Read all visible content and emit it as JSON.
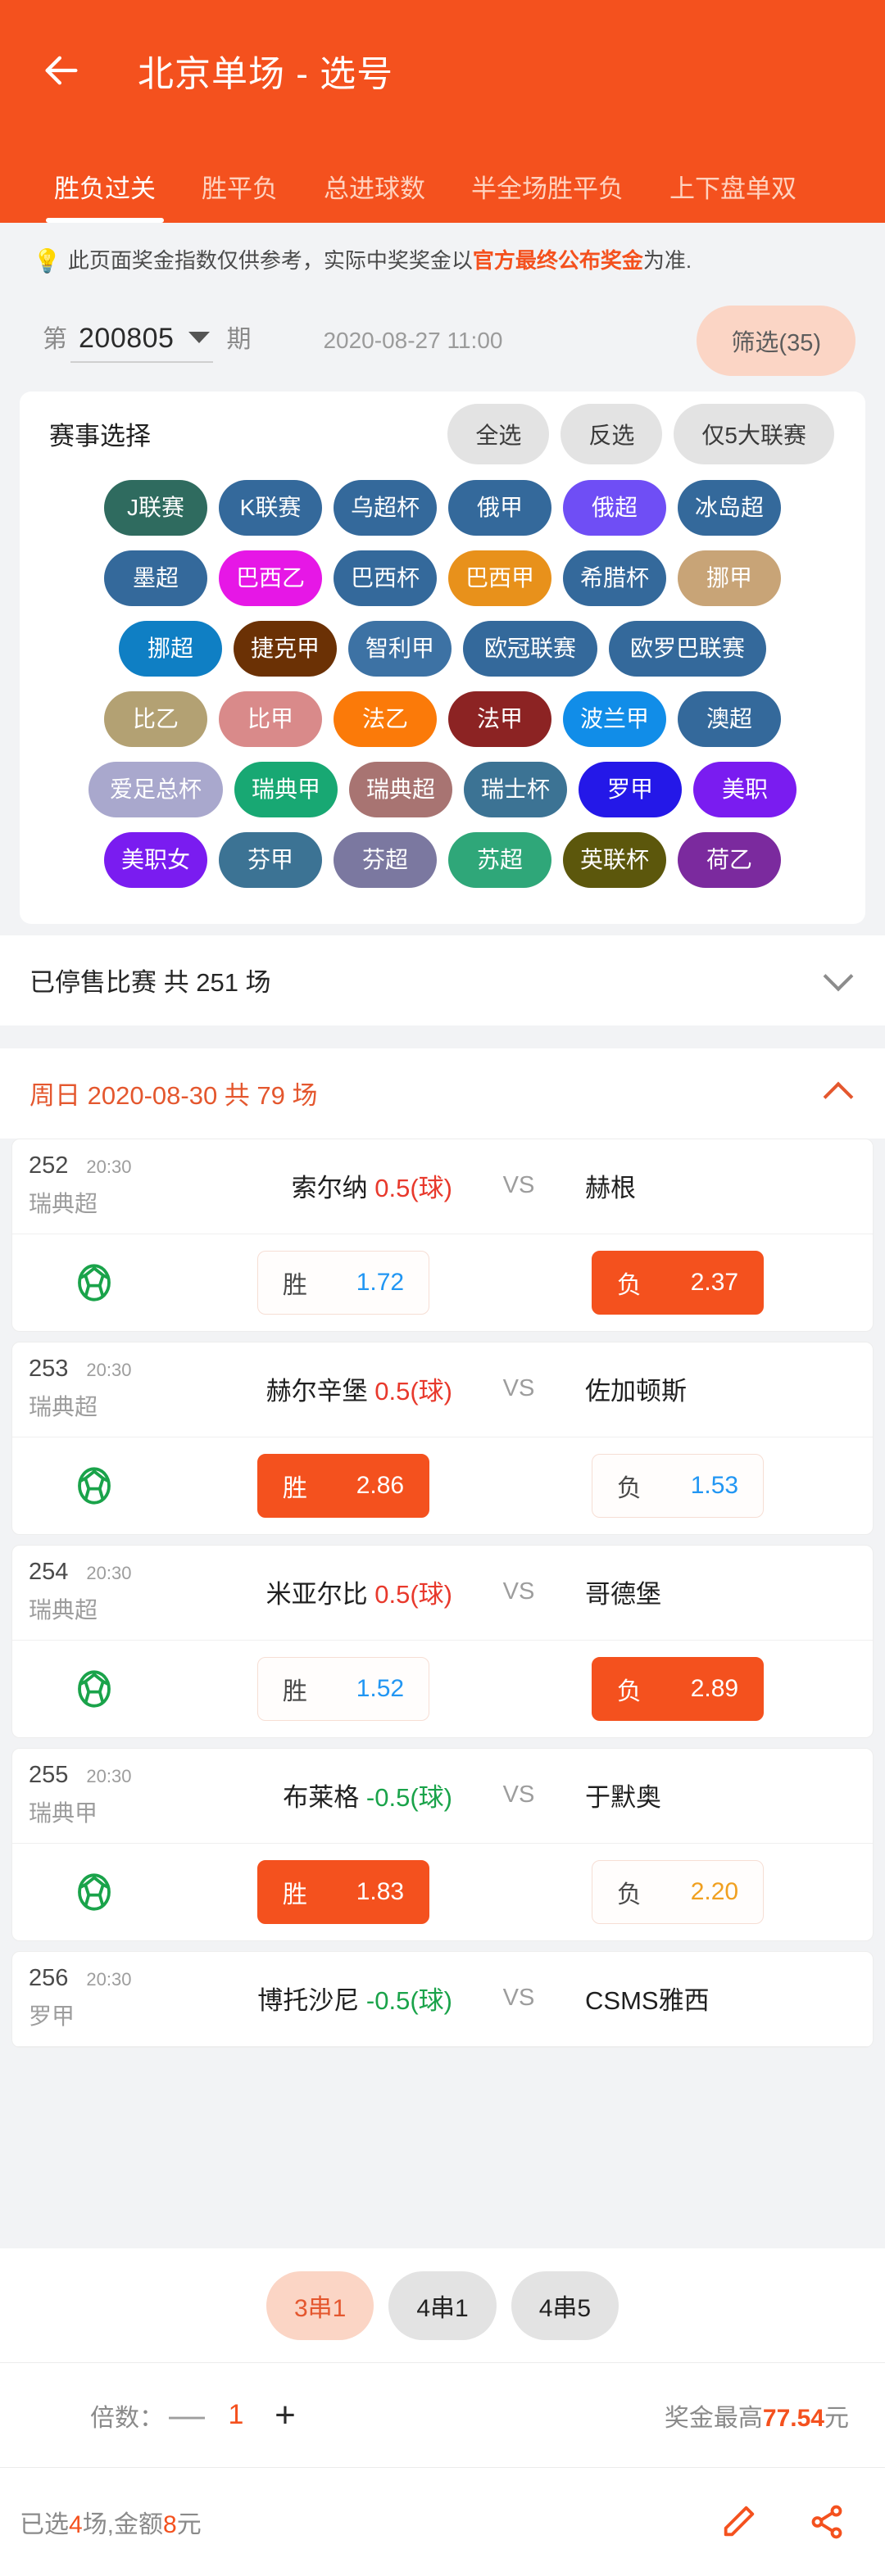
{
  "header": {
    "back_icon": "arrow-left-icon",
    "title": "北京单场 - 选号",
    "accent": "#f4511e",
    "tabs": [
      {
        "label": "胜负过关",
        "active": true
      },
      {
        "label": "胜平负",
        "active": false
      },
      {
        "label": "总进球数",
        "active": false
      },
      {
        "label": "半全场胜平负",
        "active": false
      },
      {
        "label": "上下盘单双",
        "active": false
      }
    ]
  },
  "notice": {
    "icon": "lightbulb-icon",
    "text_before": "此页面奖金指数仅供参考，实际中奖奖金以",
    "highlight": "官方最终公布奖金",
    "text_after": "为准."
  },
  "period": {
    "prefix": "第",
    "value": "200805",
    "suffix": "期",
    "dropdown_icon": "caret-down-icon",
    "datetime": "2020-08-27 11:00",
    "filter_label": "筛选(35)"
  },
  "league_panel": {
    "title": "赛事选择",
    "buttons": [
      {
        "label": "全选"
      },
      {
        "label": "反选"
      },
      {
        "label": "仅5大联赛"
      }
    ],
    "rows": [
      [
        {
          "label": "J联赛",
          "color": "#2f6b5f"
        },
        {
          "label": "K联赛",
          "color": "#34699b"
        },
        {
          "label": "乌超杯",
          "color": "#34699b"
        },
        {
          "label": "俄甲",
          "color": "#34699b"
        },
        {
          "label": "俄超",
          "color": "#6f4ef5"
        },
        {
          "label": "冰岛超",
          "color": "#34699b"
        }
      ],
      [
        {
          "label": "墨超",
          "color": "#34699b"
        },
        {
          "label": "巴西乙",
          "color": "#e617e6"
        },
        {
          "label": "巴西杯",
          "color": "#34699b"
        },
        {
          "label": "巴西甲",
          "color": "#e8911b"
        },
        {
          "label": "希腊杯",
          "color": "#34699b"
        },
        {
          "label": "挪甲",
          "color": "#c8a477"
        }
      ],
      [
        {
          "label": "挪超",
          "color": "#0f7fc4"
        },
        {
          "label": "捷克甲",
          "color": "#6b3105"
        },
        {
          "label": "智利甲",
          "color": "#3d72a4"
        },
        {
          "label": "欧冠联赛",
          "color": "#34699b"
        },
        {
          "label": "欧罗巴联赛",
          "color": "#34699b"
        }
      ],
      [
        {
          "label": "比乙",
          "color": "#b3a173"
        },
        {
          "label": "比甲",
          "color": "#d98a8a"
        },
        {
          "label": "法乙",
          "color": "#fb7a09"
        },
        {
          "label": "法甲",
          "color": "#8c2323"
        },
        {
          "label": "波兰甲",
          "color": "#118de8"
        },
        {
          "label": "澳超",
          "color": "#34699b"
        }
      ],
      [
        {
          "label": "爱足总杯",
          "color": "#a9a8cd"
        },
        {
          "label": "瑞典甲",
          "color": "#18a873"
        },
        {
          "label": "瑞典超",
          "color": "#a87472"
        },
        {
          "label": "瑞士杯",
          "color": "#3c7394"
        },
        {
          "label": "罗甲",
          "color": "#2418e8"
        },
        {
          "label": "美职",
          "color": "#7a1cf0"
        }
      ],
      [
        {
          "label": "美职女",
          "color": "#7a1cf0"
        },
        {
          "label": "芬甲",
          "color": "#3c7394"
        },
        {
          "label": "芬超",
          "color": "#7b78a0"
        },
        {
          "label": "苏超",
          "color": "#2fa779"
        },
        {
          "label": "英联杯",
          "color": "#5c570c"
        },
        {
          "label": "荷乙",
          "color": "#7b2a9e"
        }
      ]
    ]
  },
  "closed_bar": {
    "title": "已停售比赛 共 251 场",
    "icon": "chevron-down-icon"
  },
  "day_bar": {
    "title": "周日 2020-08-30 共 79 场",
    "icon": "chevron-up-icon"
  },
  "matches": [
    {
      "num": "252",
      "time": "20:30",
      "league": "瑞典超",
      "home": "索尔纳",
      "handicap": "0.5(球)",
      "handicap_sign": "pos",
      "vs": "VS",
      "away": "赫根",
      "ball_icon": "football-icon",
      "odds": [
        {
          "label": "胜",
          "value": "1.72",
          "selected": false,
          "value_color": "blue"
        },
        {
          "label": "负",
          "value": "2.37",
          "selected": true,
          "value_color": "blue"
        }
      ]
    },
    {
      "num": "253",
      "time": "20:30",
      "league": "瑞典超",
      "home": "赫尔辛堡",
      "handicap": "0.5(球)",
      "handicap_sign": "pos",
      "vs": "VS",
      "away": "佐加顿斯",
      "ball_icon": "football-icon",
      "odds": [
        {
          "label": "胜",
          "value": "2.86",
          "selected": true,
          "value_color": "blue"
        },
        {
          "label": "负",
          "value": "1.53",
          "selected": false,
          "value_color": "blue"
        }
      ]
    },
    {
      "num": "254",
      "time": "20:30",
      "league": "瑞典超",
      "home": "米亚尔比",
      "handicap": "0.5(球)",
      "handicap_sign": "pos",
      "vs": "VS",
      "away": "哥德堡",
      "ball_icon": "football-icon",
      "odds": [
        {
          "label": "胜",
          "value": "1.52",
          "selected": false,
          "value_color": "blue"
        },
        {
          "label": "负",
          "value": "2.89",
          "selected": true,
          "value_color": "blue"
        }
      ]
    },
    {
      "num": "255",
      "time": "20:30",
      "league": "瑞典甲",
      "home": "布莱格",
      "handicap": "-0.5(球)",
      "handicap_sign": "neg",
      "vs": "VS",
      "away": "于默奥",
      "ball_icon": "football-icon",
      "odds": [
        {
          "label": "胜",
          "value": "1.83",
          "selected": true,
          "value_color": "blue"
        },
        {
          "label": "负",
          "value": "2.20",
          "selected": false,
          "value_color": "amber"
        }
      ]
    },
    {
      "num": "256",
      "time": "20:30",
      "league": "罗甲",
      "home": "博托沙尼",
      "handicap": "-0.5(球)",
      "handicap_sign": "neg",
      "vs": "VS",
      "away": "CSMS雅西",
      "ball_icon": "football-icon",
      "odds": []
    }
  ],
  "bottom": {
    "combos": [
      {
        "label": "3串1",
        "active": true
      },
      {
        "label": "4串1",
        "active": false
      },
      {
        "label": "4串5",
        "active": false
      }
    ],
    "multiplier": {
      "label": "倍数：",
      "minus": "—",
      "value": "1",
      "plus": "+",
      "prize_prefix": "奖金最高",
      "prize_amount": "77.54",
      "prize_suffix": "元"
    },
    "summary": {
      "p1": "已选",
      "count": "4",
      "p2": "场,金额",
      "amount": "8",
      "p3": "元",
      "edit_icon": "pencil-icon",
      "share_icon": "share-icon"
    }
  }
}
